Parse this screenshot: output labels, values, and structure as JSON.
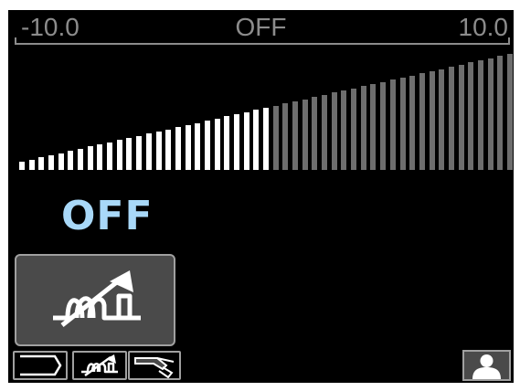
{
  "scale": {
    "min_label": "-10.0",
    "center_label": "OFF",
    "max_label": "10.0"
  },
  "bar_graph": {
    "bar_count": 51,
    "active_bars": 26,
    "active_color": "#ffffff",
    "inactive_color": "#6e6e6e"
  },
  "status": {
    "value": "OFF"
  },
  "colors": {
    "screen_background": "#000000",
    "value_text": "#a8d8f8",
    "button_fill": "#4a4a4a",
    "border": "#a0a0a0"
  },
  "icons": {
    "mode_button": "arc-control-icon",
    "tab_back": "back-arrow-icon",
    "tab_mode": "arc-control-icon",
    "tab_torch": "welding-torch-icon",
    "user": "user-profile-icon"
  }
}
